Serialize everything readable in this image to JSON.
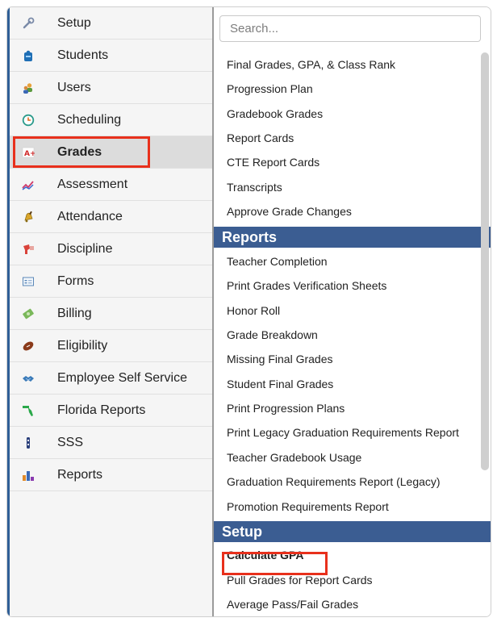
{
  "sidebar": {
    "items": [
      {
        "label": "Setup",
        "icon": "wrench-icon"
      },
      {
        "label": "Students",
        "icon": "student-icon"
      },
      {
        "label": "Users",
        "icon": "users-icon"
      },
      {
        "label": "Scheduling",
        "icon": "clock-icon"
      },
      {
        "label": "Grades",
        "icon": "grades-icon"
      },
      {
        "label": "Assessment",
        "icon": "assessment-icon"
      },
      {
        "label": "Attendance",
        "icon": "bell-icon"
      },
      {
        "label": "Discipline",
        "icon": "whistle-icon"
      },
      {
        "label": "Forms",
        "icon": "form-icon"
      },
      {
        "label": "Billing",
        "icon": "money-icon"
      },
      {
        "label": "Eligibility",
        "icon": "football-icon"
      },
      {
        "label": "Employee Self Service",
        "icon": "handshake-icon"
      },
      {
        "label": "Florida Reports",
        "icon": "florida-icon"
      },
      {
        "label": "SSS",
        "icon": "sss-icon"
      },
      {
        "label": "Reports",
        "icon": "bar-chart-icon"
      }
    ],
    "active": "Grades"
  },
  "search": {
    "placeholder": "Search..."
  },
  "menu": {
    "items_top": [
      "Final Grades, GPA, & Class Rank",
      "Progression Plan",
      "Gradebook Grades",
      "Report Cards",
      "CTE Report Cards",
      "Transcripts",
      "Approve Grade Changes"
    ],
    "reports_header": "Reports",
    "reports_items": [
      "Teacher Completion",
      "Print Grades Verification Sheets",
      "Honor Roll",
      "Grade Breakdown",
      "Missing Final Grades",
      "Student Final Grades",
      "Print Progression Plans",
      "Print Legacy Graduation Requirements Report",
      "Teacher Gradebook Usage",
      "Graduation Requirements Report (Legacy)",
      "Promotion Requirements Report"
    ],
    "setup_header": "Setup",
    "setup_items": [
      "Calculate GPA",
      "Pull Grades for Report Cards",
      "Average Pass/Fail Grades"
    ]
  },
  "colors": {
    "section_header_bg": "#3b5d92",
    "highlight_border": "#e8301c",
    "active_item_bg": "#dcdcdc"
  }
}
